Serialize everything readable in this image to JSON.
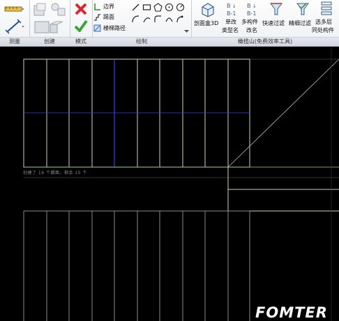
{
  "ribbon": {
    "panels": {
      "measure": "测量",
      "create": "创建",
      "mode": "模式",
      "draw": "绘制",
      "addon": "橄榄山(免费效率工具)"
    },
    "mode": {
      "boundary": "边界",
      "riser": "踢面",
      "stair_path": "楼梯路径"
    },
    "addon_tools": {
      "section_box_3d": "剖面盒3D",
      "single_change_line1": "单改",
      "single_change_line2": "类型名",
      "multi_change_line1": "多构件",
      "multi_change_line2": "改名",
      "quick_filter": "快速过滤",
      "fine_filter": "精细过滤",
      "multi_floor_line1": "选多层",
      "multi_floor_line2": "同处构件"
    }
  },
  "canvas": {
    "status_text": "创建了 16 个踢面，剩余 15 个",
    "watermark": "FOMTER"
  },
  "colors": {
    "canvas_bg": "#000000",
    "stair_lines": "#c8d8b0",
    "stair_path": "#3a3aff",
    "boundary_green": "#8fd18f",
    "cancel_red": "#d9272e",
    "finish_green": "#3aa63a"
  },
  "icons": [
    "dimension-icon",
    "measure-icon",
    "create-part-icon",
    "create-group-icon",
    "create-similar-icon",
    "cancel-edit-icon",
    "finish-edit-icon",
    "boundary-icon",
    "riser-icon",
    "stair-path-icon",
    "line-icon",
    "rectangle-icon",
    "polygon-icon",
    "circle-icon",
    "arc-icon",
    "fillet-icon",
    "tangent-arc-icon",
    "spline-icon",
    "section-box-icon",
    "type-rename-icon",
    "multi-rename-icon",
    "quick-filter-icon",
    "fine-filter-icon",
    "multi-floor-select-icon"
  ]
}
